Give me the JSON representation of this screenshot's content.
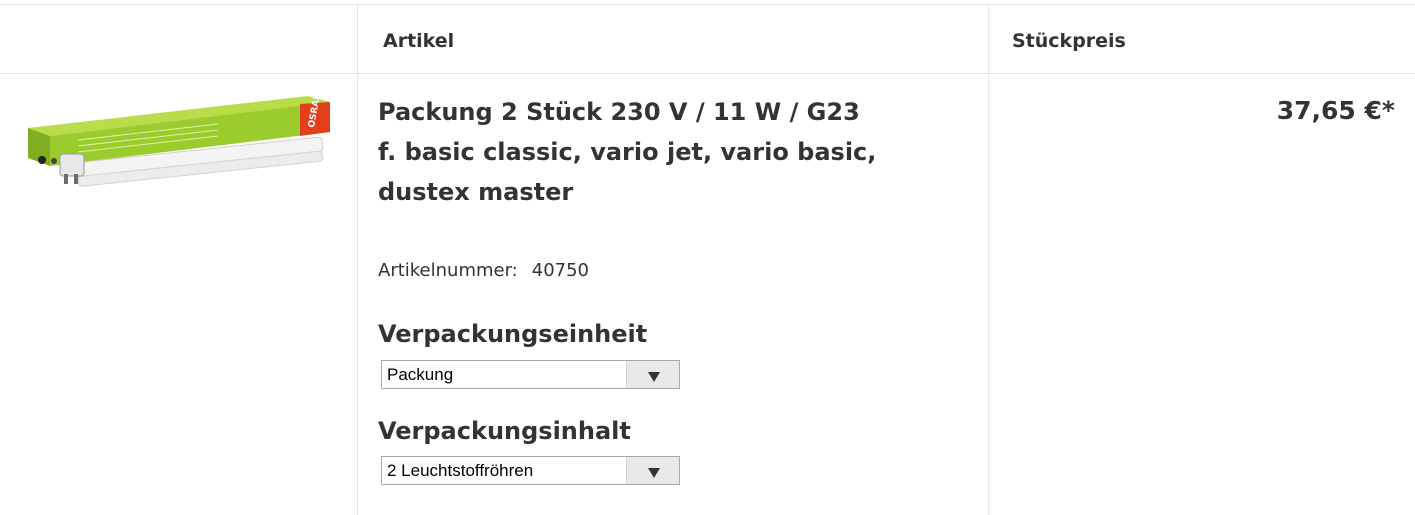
{
  "header": {
    "col_article": "Artikel",
    "col_unit_price": "Stückpreis"
  },
  "product": {
    "title_lines": [
      "Packung 2 Stück 230 V / 11 W / G23",
      "f. basic classic, vario jet, vario basic,",
      "dustex master"
    ],
    "article_number_label": "Artikelnummer:",
    "article_number": "40750",
    "image_icon": "fluorescent-tube-product-image",
    "image_brand_text": "OSRAM",
    "options": [
      {
        "label": "Verpackungseinheit",
        "value": "Packung"
      },
      {
        "label": "Verpackungsinhalt",
        "value": "2 Leuchtstoffröhren"
      }
    ],
    "price": "37,65 €*"
  },
  "colors": {
    "border": "#e5e5e5",
    "text": "#333333",
    "box_green": "#9bcc2e",
    "box_accent": "#e2401c"
  }
}
